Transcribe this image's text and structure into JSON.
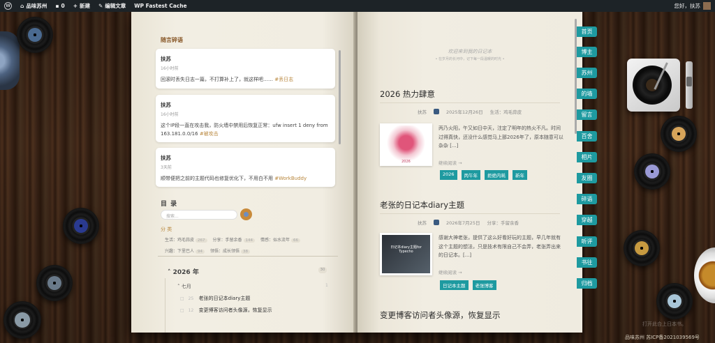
{
  "adminbar": {
    "site": "品味苏州",
    "comments": "0",
    "new": "新建",
    "edit": "编辑文章",
    "cache": "WP Fastest Cache",
    "greeting": "您好，扶苏"
  },
  "left": {
    "section_title": "随言碎语",
    "notes": [
      {
        "author": "扶苏",
        "time": "16小时前",
        "text": "回滚时丢失日志一篇，不打算补上了，就这样吧……",
        "tag": "#丢日志"
      },
      {
        "author": "扶苏",
        "time": "16小时前",
        "text": "这个IP段一直在攻击我，防火墙中禁用后恢复正常：ufw insert 1 deny from 163.181.0.0/16",
        "tag": "#被攻击"
      },
      {
        "author": "扶苏",
        "time": "3天前",
        "text": "顺带便把之前的主题代码也修复优化下，不用白不用",
        "tag": "#WorkBuddy"
      }
    ],
    "toc_title": "目 录",
    "search_placeholder": "搜索...",
    "cat_title": "分 类",
    "cats_row1": [
      {
        "name": "生活：鸡毛蒜皮",
        "count": "267"
      },
      {
        "name": "分享：手留余香",
        "count": "144"
      },
      {
        "name": "情感：似水流年",
        "count": "66"
      }
    ],
    "cats_row2": [
      {
        "name": "兴趣：下里巴人",
        "count": "94"
      },
      {
        "name": "领悟：成长领悟",
        "count": "38"
      }
    ],
    "year": "2026 年",
    "year_count": "30",
    "month": "七月",
    "month_count": "1",
    "archive": [
      {
        "day": "25",
        "title": "老张的日记本diary主题"
      },
      {
        "day": "12",
        "title": "变更博客访问者头像源，恢复显示"
      }
    ]
  },
  "right": {
    "header": "欢迎来到我的日记本",
    "subheader": "• 在岁月的长河中，记下每一段温暖的时光 •",
    "posts": [
      {
        "title": "2026 热力肆意",
        "author": "扶苏",
        "date": "2025年12月26日",
        "category": "生活：鸡毛蒜皮",
        "excerpt": "丙乃火阳，午又如日中天，注定了明年的热火不凡。时间过得真快，还没什么感觉马上那2026年了，原本随意可以杂杂 [...]",
        "readmore": "继续阅读 →",
        "tags": [
          "2026",
          "丙午年",
          "拒绝内耗",
          "新年"
        ],
        "thumb_text": "2026"
      },
      {
        "title": "老张的日记本diary主题",
        "author": "扶苏",
        "date": "2026年7月25日",
        "category": "分享：手留余香",
        "excerpt": "感谢大神老张，提供了这么好看好玩的主题，早几年就有这个主题的想法，只是技术有限自己不会弄，老张弄出来的日记本。[...]",
        "readmore": "继续阅读 →",
        "tags": [
          "日记本主题",
          "老张博客"
        ],
        "thumb_text": "日记本diary主题for Typecho"
      }
    ],
    "next_title": "变更博客访问者头像源，恢复显示"
  },
  "nav": [
    "首页",
    "博主",
    "苏州",
    "的墙",
    "留言",
    "百舍",
    "相片",
    "友圈",
    "碎语",
    "穿越",
    "听评",
    "书往",
    "归档"
  ],
  "footer": {
    "faint": "打开此合上日本书。",
    "icp": "品味苏州 苏ICP备2021039569号"
  }
}
